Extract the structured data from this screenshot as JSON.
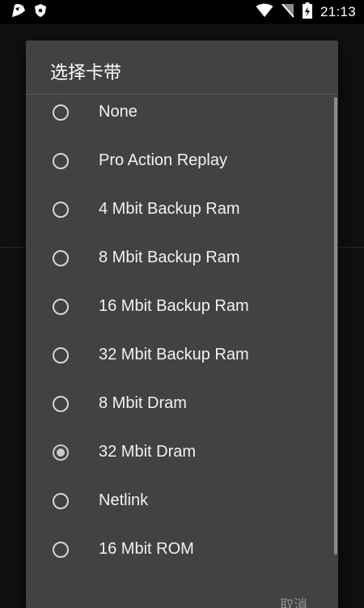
{
  "status_bar": {
    "time": "21:13",
    "icons": [
      "app-logo-icon",
      "shield-icon",
      "wifi-icon",
      "no-sim-icon",
      "battery-charging-icon"
    ]
  },
  "dialog": {
    "title": "选择卡带",
    "options": [
      {
        "label": "None",
        "checked": false
      },
      {
        "label": "Pro Action Replay",
        "checked": false
      },
      {
        "label": "4 Mbit Backup Ram",
        "checked": false
      },
      {
        "label": "8 Mbit Backup Ram",
        "checked": false
      },
      {
        "label": "16 Mbit Backup Ram",
        "checked": false
      },
      {
        "label": "32 Mbit Backup Ram",
        "checked": false
      },
      {
        "label": "8 Mbit Dram",
        "checked": false
      },
      {
        "label": "32 Mbit Dram",
        "checked": true
      },
      {
        "label": "Netlink",
        "checked": false
      },
      {
        "label": "16 Mbit ROM",
        "checked": false
      }
    ],
    "cancel_label": "取消"
  },
  "colors": {
    "dialog_bg": "#424242",
    "background": "#101010",
    "radio": "#d6d6d6"
  }
}
